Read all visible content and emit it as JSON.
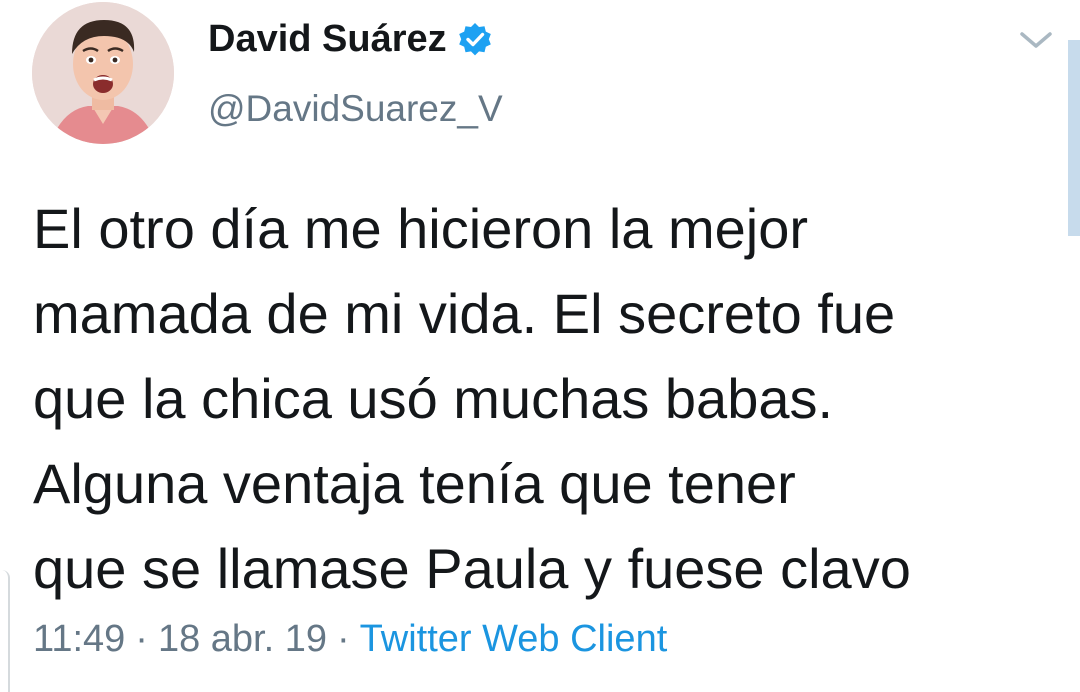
{
  "user": {
    "display_name": "David Suárez",
    "handle": "@DavidSuarez_V",
    "verified_icon": "verified-badge-icon",
    "avatar": "profile-photo"
  },
  "menu": {
    "icon": "chevron-down-icon"
  },
  "tweet": {
    "lines": [
      "El otro día me hicieron la mejor",
      "mamada de mi vida. El secreto fue",
      "que la chica usó muchas babas.",
      "Alguna ventaja tenía que tener",
      "que se llamase Paula y fuese clavo"
    ]
  },
  "meta": {
    "time": "11:49",
    "separator": "·",
    "date": "18 abr. 19",
    "source": "Twitter Web Client"
  },
  "colors": {
    "text": "#14171a",
    "secondary": "#657786",
    "link": "#1b95e0",
    "verified": "#1da1f2"
  }
}
